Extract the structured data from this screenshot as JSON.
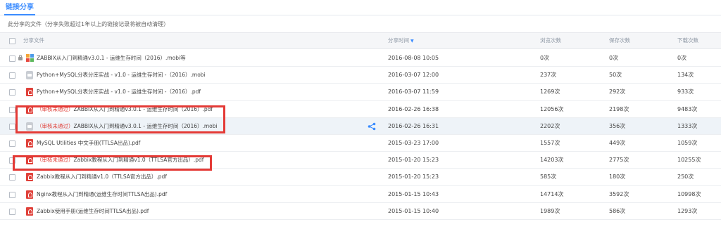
{
  "tab": {
    "label": "链接分享"
  },
  "notice": "此分享的文件（分享失败超过1年以上的链接记录将被自动清理）",
  "columns": {
    "file": "分享文件",
    "time": "分享时间",
    "views": "浏览次数",
    "saves": "保存次数",
    "downloads": "下载次数"
  },
  "rows": [
    {
      "prefix": "",
      "name": "ZABBIX从入门到精通v3.0.1 - 运维生存时间（2016）.mobi等",
      "time": "2016-08-08 10:05",
      "views": "0次",
      "saves": "0次",
      "downloads": "0次"
    },
    {
      "prefix": "",
      "name": "Python+MySQL分表分库实战 - v1.0 - 运维生存时间 -（2016）.mobi",
      "time": "2016-03-07 12:00",
      "views": "237次",
      "saves": "50次",
      "downloads": "134次"
    },
    {
      "prefix": "",
      "name": "Python+MySQL分表分库实战 - v1.0 - 运维生存时间 -（2016）.pdf",
      "time": "2016-03-07 11:59",
      "views": "1269次",
      "saves": "292次",
      "downloads": "933次"
    },
    {
      "prefix": "（审核未通过）",
      "name": "ZABBIX从入门到精通v3.0.1 - 运维生存时间（2016）.pdf",
      "time": "2016-02-26 16:38",
      "views": "12056次",
      "saves": "2198次",
      "downloads": "9483次"
    },
    {
      "prefix": "（审核未通过）",
      "name": "ZABBIX从入门到精通v3.0.1 - 运维生存时间（2016）.mobi",
      "time": "2016-02-26 16:31",
      "views": "2202次",
      "saves": "356次",
      "downloads": "1333次"
    },
    {
      "prefix": "",
      "name": "MySQL Utilities 中文手册(TTLSA出品).pdf",
      "time": "2015-03-23 17:00",
      "views": "1557次",
      "saves": "449次",
      "downloads": "1059次"
    },
    {
      "prefix": "（审核未通过）",
      "name": "Zabbix教程从入门到精通v1.0（TTLSA官方出品）.pdf",
      "time": "2015-01-20 15:23",
      "views": "14203次",
      "saves": "2775次",
      "downloads": "10255次"
    },
    {
      "prefix": "",
      "name": "Zabbix教程从入门到精通v1.0（TTLSA官方出品）.pdf",
      "time": "2015-01-20 15:23",
      "views": "585次",
      "saves": "180次",
      "downloads": "250次"
    },
    {
      "prefix": "",
      "name": "Nginx教程从入门到精通(运维生存时间TTLSA出品).pdf",
      "time": "2015-01-15 10:43",
      "views": "14714次",
      "saves": "3592次",
      "downloads": "10998次"
    },
    {
      "prefix": "",
      "name": "Zabbix使用手册(运维生存时间TTLSA出品).pdf",
      "time": "2015-01-15 10:40",
      "views": "1989次",
      "saves": "586次",
      "downloads": "1293次"
    }
  ],
  "colors": {
    "accent": "#3b8cff",
    "reject": "#e0413a",
    "highlight_box": "#e43a36"
  }
}
